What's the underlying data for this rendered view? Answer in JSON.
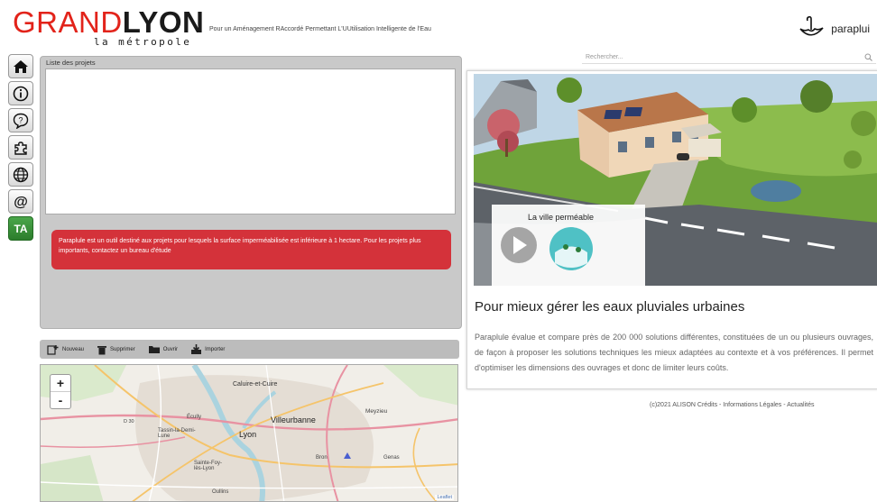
{
  "header": {
    "logo_grand": "GRAND",
    "logo_lyon": "LYON",
    "logo_sub": "la métropole",
    "tagline": "Pour un Aménagement RAccordé Permettant L'UUtilisation Intelligente de l'Eau",
    "brand": "paraplui"
  },
  "toolbar": {
    "buttons": [
      {
        "icon": "home-icon",
        "glyph": "🏠"
      },
      {
        "icon": "info-icon",
        "glyph": "ⓘ"
      },
      {
        "icon": "help-icon",
        "glyph": "?"
      },
      {
        "icon": "puzzle-icon",
        "glyph": "✿"
      },
      {
        "icon": "globe-icon",
        "glyph": "🌐"
      },
      {
        "icon": "at-icon",
        "glyph": "@"
      },
      {
        "icon": "ta-icon",
        "glyph": "TA"
      }
    ]
  },
  "projects": {
    "title": "Liste des projets",
    "alert": "Paraplule est un outil destiné aux projets pour lesquels la surface imperméabilisée est inférieure à 1 hectare. Pour les projets plus importants, contactez un bureau d'étude"
  },
  "actions": {
    "new": "Nouveau",
    "delete": "Supprimer",
    "open": "Ouvrir",
    "import": "Importer"
  },
  "map": {
    "labels": {
      "caluire": "Caluire-et-Cuire",
      "villeurbanne": "Villeurbanne",
      "meyzieu": "Meyzieu",
      "lyon": "Lyon",
      "tassin": "Tassin-la-Demi-Lune",
      "ecully": "Écully",
      "sainte_foy": "Sainte-Foy-lès-Lyon",
      "oullins": "Oullins",
      "bron": "Bron",
      "genas": "Genas",
      "d30": "D 30",
      "leaflet": "Leaflet"
    },
    "zoom_in": "+",
    "zoom_out": "-"
  },
  "search": {
    "placeholder": "Rechercher..."
  },
  "card": {
    "video_title": "La ville perméable",
    "heading": "Pour mieux gérer les eaux pluviales urbaines",
    "description": "Paraplule évalue et compare près de 200 000 solutions différentes, constituées de un ou plusieurs ouvrages, de façon à proposer les solutions techniques les mieux adaptées au contexte et à vos préférences. Il permet d'optimiser les dimensions des ouvrages et donc de limiter leurs coûts."
  },
  "footer": "(c)2021 ALISON Crédits - Informations Légales - Actualités",
  "colors": {
    "brand_red": "#e2231a",
    "alert_red": "#d4323a",
    "panel_gray": "#c9c9c9",
    "ta_green": "#3a913a"
  }
}
